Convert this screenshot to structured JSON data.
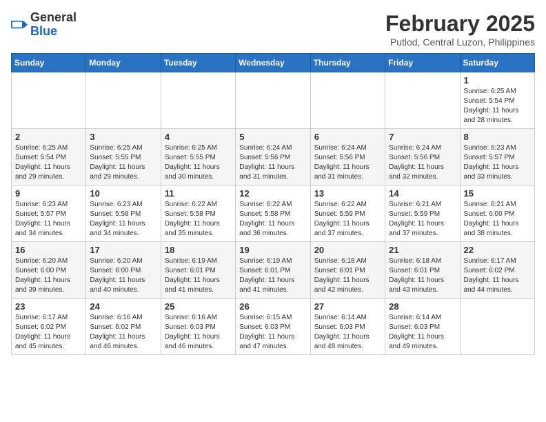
{
  "header": {
    "logo_general": "General",
    "logo_blue": "Blue",
    "month_year": "February 2025",
    "location": "Putlod, Central Luzon, Philippines"
  },
  "weekdays": [
    "Sunday",
    "Monday",
    "Tuesday",
    "Wednesday",
    "Thursday",
    "Friday",
    "Saturday"
  ],
  "weeks": [
    [
      {
        "day": "",
        "info": ""
      },
      {
        "day": "",
        "info": ""
      },
      {
        "day": "",
        "info": ""
      },
      {
        "day": "",
        "info": ""
      },
      {
        "day": "",
        "info": ""
      },
      {
        "day": "",
        "info": ""
      },
      {
        "day": "1",
        "info": "Sunrise: 6:25 AM\nSunset: 5:54 PM\nDaylight: 11 hours\nand 28 minutes."
      }
    ],
    [
      {
        "day": "2",
        "info": "Sunrise: 6:25 AM\nSunset: 5:54 PM\nDaylight: 11 hours\nand 29 minutes."
      },
      {
        "day": "3",
        "info": "Sunrise: 6:25 AM\nSunset: 5:55 PM\nDaylight: 11 hours\nand 29 minutes."
      },
      {
        "day": "4",
        "info": "Sunrise: 6:25 AM\nSunset: 5:55 PM\nDaylight: 11 hours\nand 30 minutes."
      },
      {
        "day": "5",
        "info": "Sunrise: 6:24 AM\nSunset: 5:56 PM\nDaylight: 11 hours\nand 31 minutes."
      },
      {
        "day": "6",
        "info": "Sunrise: 6:24 AM\nSunset: 5:56 PM\nDaylight: 11 hours\nand 31 minutes."
      },
      {
        "day": "7",
        "info": "Sunrise: 6:24 AM\nSunset: 5:56 PM\nDaylight: 11 hours\nand 32 minutes."
      },
      {
        "day": "8",
        "info": "Sunrise: 6:23 AM\nSunset: 5:57 PM\nDaylight: 11 hours\nand 33 minutes."
      }
    ],
    [
      {
        "day": "9",
        "info": "Sunrise: 6:23 AM\nSunset: 5:57 PM\nDaylight: 11 hours\nand 34 minutes."
      },
      {
        "day": "10",
        "info": "Sunrise: 6:23 AM\nSunset: 5:58 PM\nDaylight: 11 hours\nand 34 minutes."
      },
      {
        "day": "11",
        "info": "Sunrise: 6:22 AM\nSunset: 5:58 PM\nDaylight: 11 hours\nand 35 minutes."
      },
      {
        "day": "12",
        "info": "Sunrise: 6:22 AM\nSunset: 5:58 PM\nDaylight: 11 hours\nand 36 minutes."
      },
      {
        "day": "13",
        "info": "Sunrise: 6:22 AM\nSunset: 5:59 PM\nDaylight: 11 hours\nand 37 minutes."
      },
      {
        "day": "14",
        "info": "Sunrise: 6:21 AM\nSunset: 5:59 PM\nDaylight: 11 hours\nand 37 minutes."
      },
      {
        "day": "15",
        "info": "Sunrise: 6:21 AM\nSunset: 6:00 PM\nDaylight: 11 hours\nand 38 minutes."
      }
    ],
    [
      {
        "day": "16",
        "info": "Sunrise: 6:20 AM\nSunset: 6:00 PM\nDaylight: 11 hours\nand 39 minutes."
      },
      {
        "day": "17",
        "info": "Sunrise: 6:20 AM\nSunset: 6:00 PM\nDaylight: 11 hours\nand 40 minutes."
      },
      {
        "day": "18",
        "info": "Sunrise: 6:19 AM\nSunset: 6:01 PM\nDaylight: 11 hours\nand 41 minutes."
      },
      {
        "day": "19",
        "info": "Sunrise: 6:19 AM\nSunset: 6:01 PM\nDaylight: 11 hours\nand 41 minutes."
      },
      {
        "day": "20",
        "info": "Sunrise: 6:18 AM\nSunset: 6:01 PM\nDaylight: 11 hours\nand 42 minutes."
      },
      {
        "day": "21",
        "info": "Sunrise: 6:18 AM\nSunset: 6:01 PM\nDaylight: 11 hours\nand 43 minutes."
      },
      {
        "day": "22",
        "info": "Sunrise: 6:17 AM\nSunset: 6:02 PM\nDaylight: 11 hours\nand 44 minutes."
      }
    ],
    [
      {
        "day": "23",
        "info": "Sunrise: 6:17 AM\nSunset: 6:02 PM\nDaylight: 11 hours\nand 45 minutes."
      },
      {
        "day": "24",
        "info": "Sunrise: 6:16 AM\nSunset: 6:02 PM\nDaylight: 11 hours\nand 46 minutes."
      },
      {
        "day": "25",
        "info": "Sunrise: 6:16 AM\nSunset: 6:03 PM\nDaylight: 11 hours\nand 46 minutes."
      },
      {
        "day": "26",
        "info": "Sunrise: 6:15 AM\nSunset: 6:03 PM\nDaylight: 11 hours\nand 47 minutes."
      },
      {
        "day": "27",
        "info": "Sunrise: 6:14 AM\nSunset: 6:03 PM\nDaylight: 11 hours\nand 48 minutes."
      },
      {
        "day": "28",
        "info": "Sunrise: 6:14 AM\nSunset: 6:03 PM\nDaylight: 11 hours\nand 49 minutes."
      },
      {
        "day": "",
        "info": ""
      }
    ]
  ]
}
